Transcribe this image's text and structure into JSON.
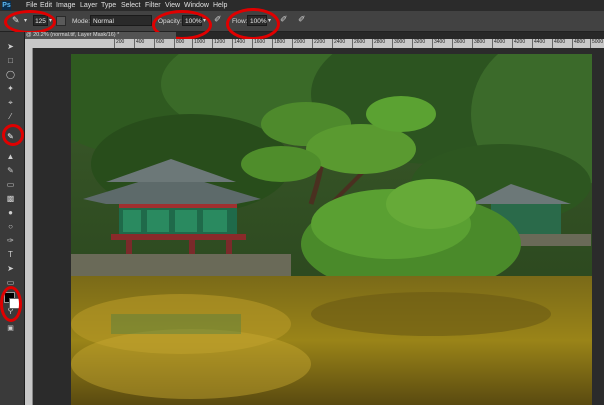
{
  "menu": {
    "logo": "Ps",
    "items": [
      "File",
      "Edit",
      "Image",
      "Layer",
      "Type",
      "Select",
      "Filter",
      "View",
      "Window",
      "Help"
    ]
  },
  "options": {
    "brush_size": "125",
    "mode_label": "Mode:",
    "mode_value": "Normal",
    "opacity_label": "Opacity:",
    "opacity_value": "100%",
    "flow_label": "Flow:",
    "flow_value": "100%"
  },
  "document": {
    "tab_title": "@ 20.2% (normal.tif, Layer Mask/16) *"
  },
  "ruler": {
    "ticks": [
      "200",
      "400",
      "600",
      "800",
      "1000",
      "1200",
      "1400",
      "1600",
      "1800",
      "2000",
      "2200",
      "2400",
      "2600",
      "2800",
      "3000",
      "3200",
      "3400",
      "3600",
      "3800",
      "4000",
      "4200",
      "4400",
      "4600",
      "4800",
      "5000",
      "5200"
    ]
  },
  "colors": {
    "highlight": "#e00000",
    "foreground_swatch": "#000000",
    "background_swatch": "#ffffff"
  }
}
